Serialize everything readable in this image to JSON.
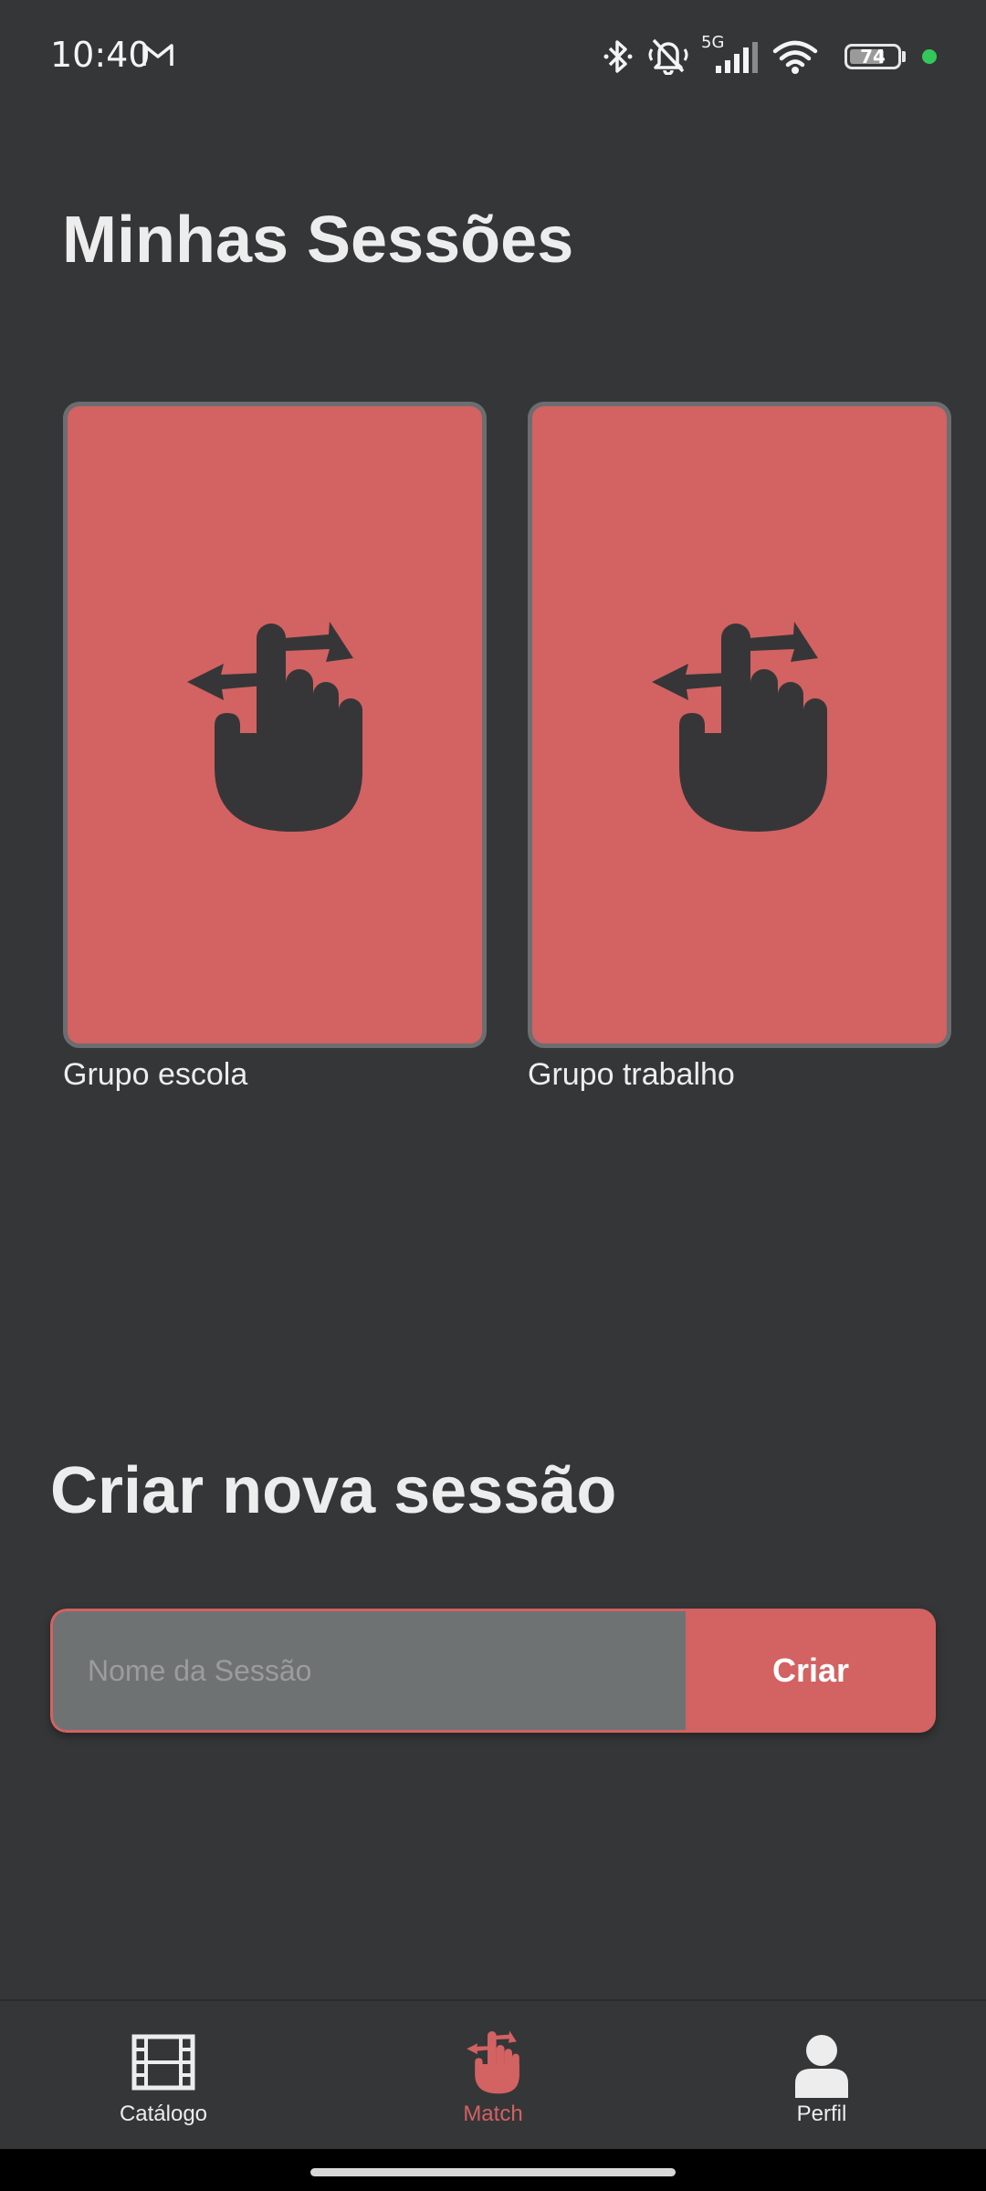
{
  "status_bar": {
    "time": "10:40",
    "battery": "74",
    "battery_level": 0.74,
    "network": "5G",
    "icons": [
      "gmail-icon",
      "bluetooth-icon",
      "vibrate-off-icon",
      "signal-icon",
      "wifi-icon",
      "battery-icon",
      "privacy-dot"
    ]
  },
  "sessions": {
    "title": "Minhas Sessões",
    "items": [
      {
        "label": "Grupo escola",
        "icon": "swipe-gesture-icon"
      },
      {
        "label": "Grupo trabalho",
        "icon": "swipe-gesture-icon"
      }
    ]
  },
  "create": {
    "title": "Criar nova sessão",
    "input_placeholder": "Nome da Sessão",
    "input_value": "",
    "button_label": "Criar"
  },
  "nav": {
    "items": [
      {
        "label": "Catálogo",
        "icon": "film-icon",
        "active": false
      },
      {
        "label": "Match",
        "icon": "swipe-gesture-icon",
        "active": true
      },
      {
        "label": "Perfil",
        "icon": "person-icon",
        "active": false
      }
    ]
  },
  "colors": {
    "background": "#353638",
    "accent": "#d36262",
    "card_border": "#6b6d70",
    "input_bg": "#6f7273",
    "text": "#ededed",
    "status_dot": "#34c759"
  }
}
